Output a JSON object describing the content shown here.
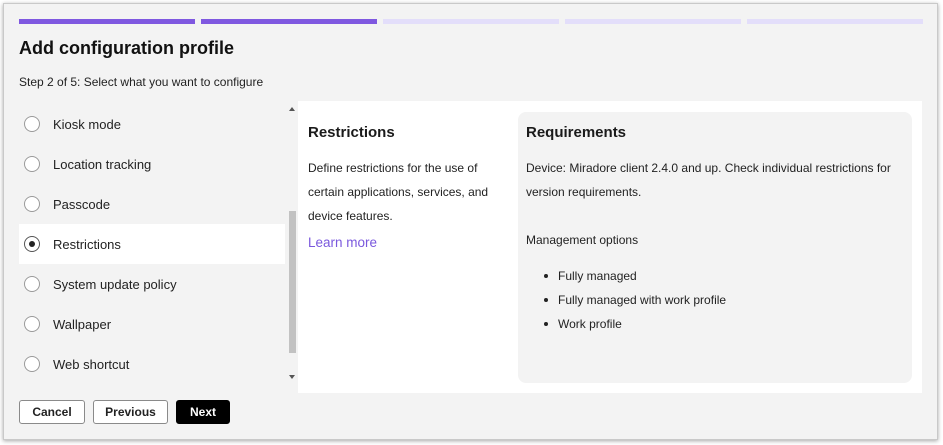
{
  "wizard": {
    "total_steps": 5,
    "completed_steps": 2,
    "title": "Add configuration profile",
    "subtitle": "Step 2 of 5: Select what you want to configure"
  },
  "options": [
    {
      "label": "Kiosk mode",
      "selected": false
    },
    {
      "label": "Location tracking",
      "selected": false
    },
    {
      "label": "Passcode",
      "selected": false
    },
    {
      "label": "Restrictions",
      "selected": true
    },
    {
      "label": "System update policy",
      "selected": false
    },
    {
      "label": "Wallpaper",
      "selected": false
    },
    {
      "label": "Web shortcut",
      "selected": false
    }
  ],
  "info": {
    "title": "Restrictions",
    "description": "Define restrictions for the use of certain applications, services, and device features.",
    "learn_more": "Learn more"
  },
  "requirements": {
    "title": "Requirements",
    "device_text": "Device: Miradore client 2.4.0 and up. Check individual restrictions for version requirements.",
    "management_label": "Management options",
    "management_options": [
      "Fully managed",
      "Fully managed with work profile",
      "Work profile"
    ]
  },
  "buttons": {
    "cancel": "Cancel",
    "previous": "Previous",
    "next": "Next"
  },
  "colors": {
    "accent": "#7f58e0",
    "accent_light": "#e3defa",
    "link": "#7a58dd",
    "primary_button": "#000000"
  }
}
